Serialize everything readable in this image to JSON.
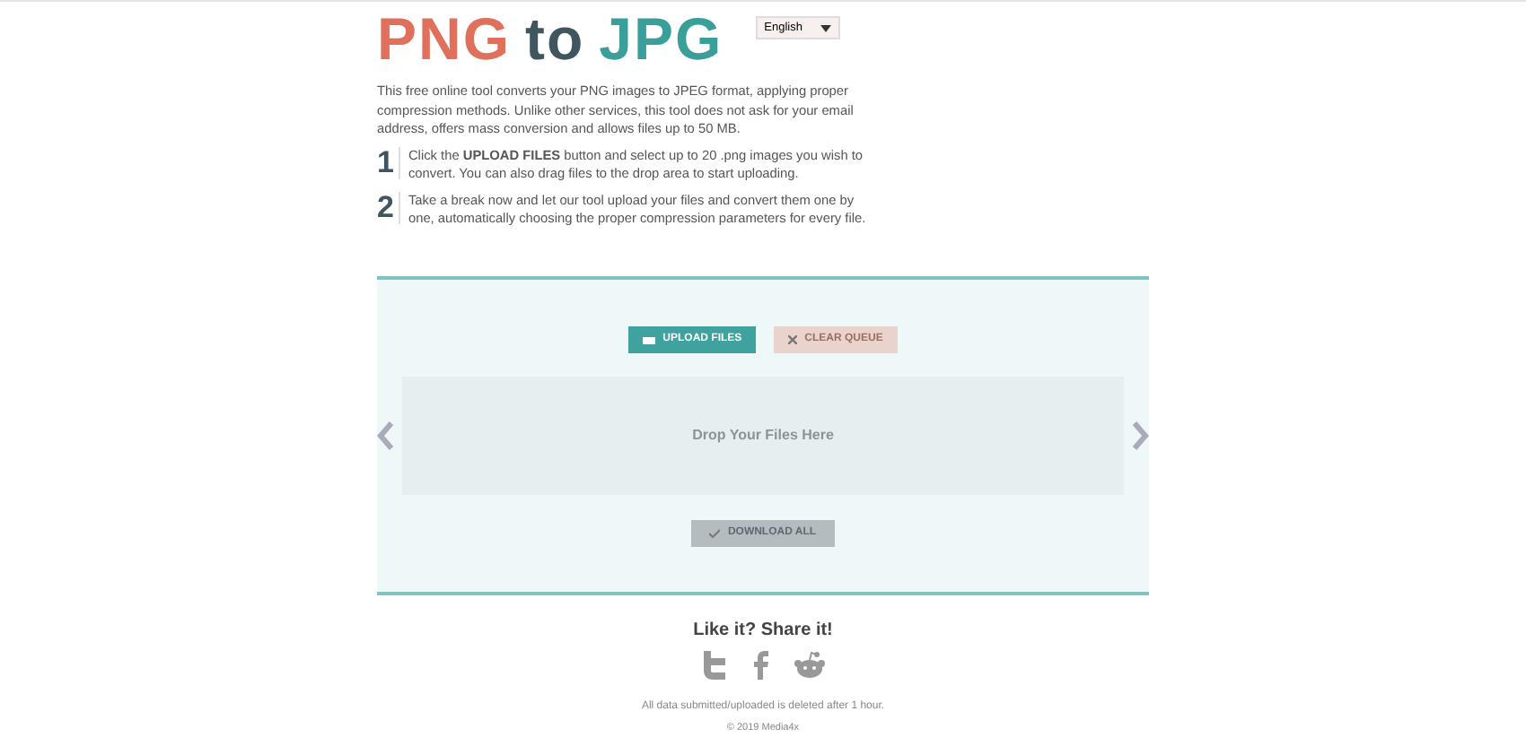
{
  "logo": {
    "part_1": "PNG",
    "part_2": "to",
    "part_3": "JPG"
  },
  "language": {
    "value": "English"
  },
  "intro": "This free online tool converts your PNG images to JPEG format, applying proper compression methods. Unlike other services, this tool does not ask for your email address, offers mass conversion and allows files up to 50 MB.",
  "steps": [
    {
      "number": "1",
      "text": "Click the **UPLOAD FILES** button and select up to 20 .png images you wish to convert. You can also drag files to the drop area to start uploading."
    },
    {
      "number": "2",
      "text": "Take a break now and let our tool upload your files and convert them one by one, automatically choosing the proper compression parameters for every file."
    }
  ],
  "buttons": [
    {
      "label": "UPLOAD FILES",
      "kind": "upload",
      "disabled": false
    },
    {
      "label": "CLEAR QUEUE",
      "kind": "clear",
      "disabled": true
    }
  ],
  "drop_area": {
    "text": "Drop Your Files Here"
  },
  "download_button": {
    "label": "DOWNLOAD ALL",
    "disabled": true
  },
  "share": {
    "title": "Like it? Share it!"
  },
  "footer": {
    "notice": "All data submitted/uploaded is deleted after 1 hour.",
    "copyright": "© 2019 Media4x"
  }
}
